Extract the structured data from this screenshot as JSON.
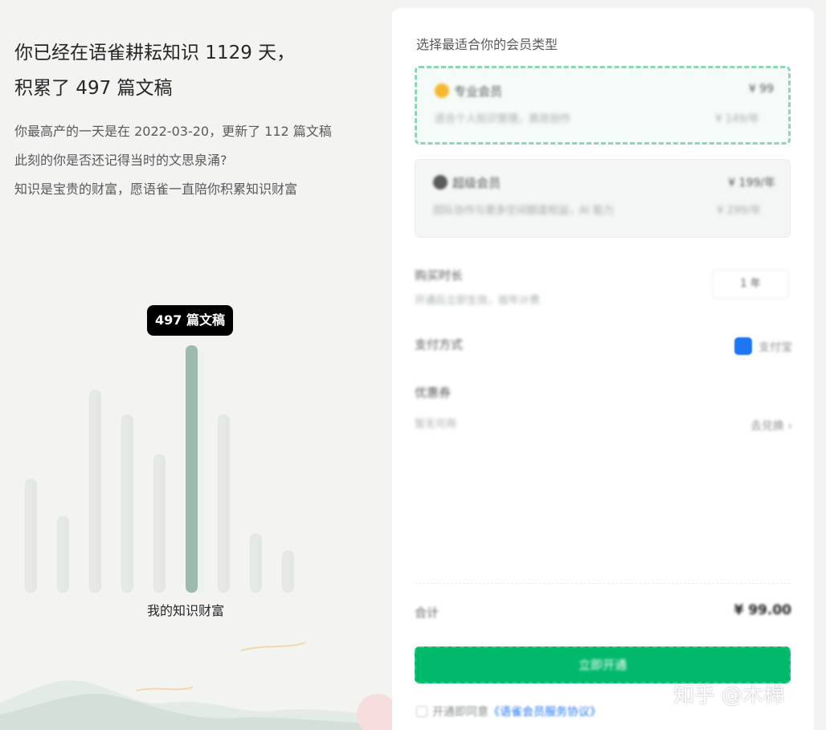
{
  "summary": {
    "headline_line1": "你已经在语雀耕耘知识 1129 天，",
    "headline_line2": "积累了 497 篇文稿",
    "desc_line1": "你最高产的一天是在 2022-03-20，更新了 112 篇文稿",
    "desc_line2": "此刻的你是否还记得当时的文思泉涌?",
    "desc_line3": "知识是宝贵的财富，愿语雀一直陪你积累知识财富"
  },
  "chart_data": {
    "type": "bar",
    "caption": "我的知识财富",
    "tooltip": "497 篇文稿",
    "highlight_index": 5,
    "bar_color": "#e3e8e5",
    "highlight_color": "#9dbaae",
    "values": [
      0.46,
      0.31,
      0.82,
      0.72,
      0.56,
      1.0,
      0.72,
      0.24,
      0.17
    ]
  },
  "membership": {
    "title": "选择最适合你的会员类型",
    "plans": [
      {
        "name": "专业会员",
        "price": "¥ 99",
        "desc": "适合个人知识管理，高效创作",
        "desc2": "¥ 149/年",
        "icon": "crown-gold-icon",
        "icon_color": "#f5b82e",
        "selected": true
      },
      {
        "name": "超级会员",
        "price": "¥ 199/年",
        "desc": "团队协作与更多空间额度权益，AI 能力",
        "desc2": "¥ 299/年",
        "icon": "crown-dark-icon",
        "icon_color": "#5a5a5a",
        "selected": false
      }
    ],
    "duration_label": "购买时长",
    "duration_sub": "开通后立即生效，按年计费",
    "duration_value": "1 年",
    "payment_label": "支付方式",
    "payment_value": "支付宝",
    "coupon_label": "优惠券",
    "coupon_sub": "暂无可用",
    "coupon_value": "去兑换 ›",
    "total_label": "合计",
    "total_value": "¥ 99.00",
    "buy_label": "立即开通",
    "agreement_prefix": "开通即同意",
    "agreement_link": "《语雀会员服务协议》"
  },
  "watermark": "知乎 @木棉"
}
